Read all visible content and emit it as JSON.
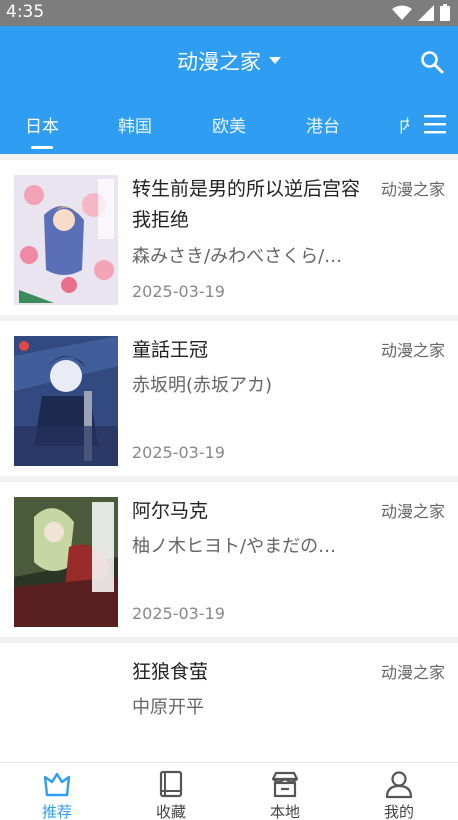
{
  "status_bar": {
    "time": "4:35"
  },
  "header": {
    "title": "动漫之家"
  },
  "tabs": [
    {
      "label": "日本"
    },
    {
      "label": "韩国"
    },
    {
      "label": "欧美"
    },
    {
      "label": "港台"
    },
    {
      "label": "内"
    }
  ],
  "comics": [
    {
      "title": "转生前是男的所以逆后宫容我拒绝",
      "author": "森みさき/みわべさくら/…",
      "date": "2025-03-19",
      "source": "动漫之家"
    },
    {
      "title": "童話王冠",
      "author": "赤坂明(赤坂アカ)",
      "date": "2025-03-19",
      "source": "动漫之家"
    },
    {
      "title": "阿尔马克",
      "author": "柚ノ木ヒヨト/やまだの…",
      "date": "2025-03-19",
      "source": "动漫之家",
      "cover_text": "阿尔马克"
    },
    {
      "title": "狂狼食萤",
      "author": "中原开平",
      "date": "",
      "source": "动漫之家"
    }
  ],
  "nav": [
    {
      "label": "推荐",
      "icon": "crown-icon"
    },
    {
      "label": "收藏",
      "icon": "book-icon"
    },
    {
      "label": "本地",
      "icon": "store-icon"
    },
    {
      "label": "我的",
      "icon": "user-icon"
    }
  ],
  "colors": {
    "accent": "#2f9ef2",
    "status_bar": "#7d7d7d"
  }
}
